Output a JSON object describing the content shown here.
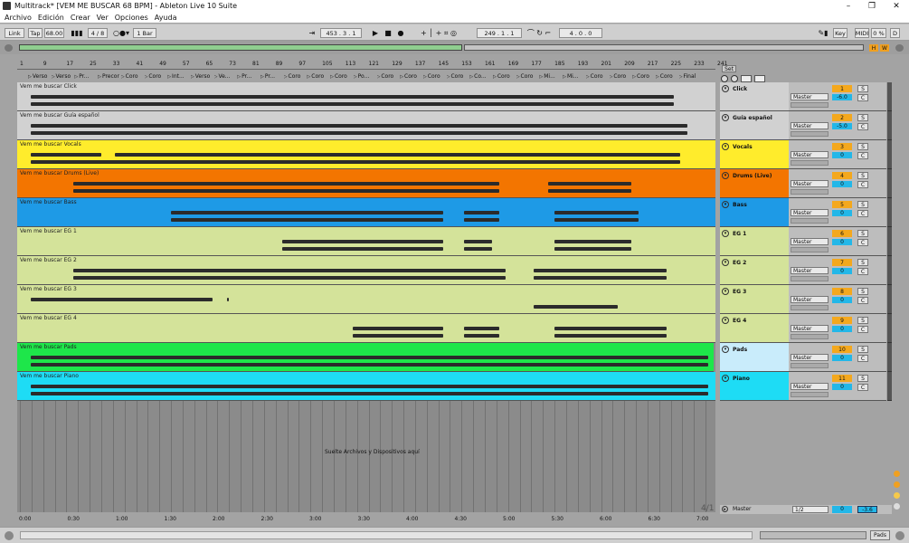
{
  "window": {
    "title": "Multitrack*  [VEM ME BUSCAR 68 BPM] - Ableton Live 10 Suite",
    "minimize": "–",
    "restore": "❐",
    "close": "✕"
  },
  "menu": [
    "Archivo",
    "Edición",
    "Crear",
    "Ver",
    "Opciones",
    "Ayuda"
  ],
  "controlbar": {
    "link": "Link",
    "tap": "Tap",
    "tempo": "68.00",
    "signature": "4 / 8",
    "metronome": "1 Bar",
    "position": "453 .   3 .   1",
    "loop_start": "249 .   1 .   1",
    "loop_length": "4 .   0 .   0",
    "key": "Key",
    "midi": "MIDI",
    "cpu": "0 %",
    "d": "D"
  },
  "overview": {
    "h": "H",
    "w": "W"
  },
  "ruler": [
    "1",
    "9",
    "17",
    "25",
    "33",
    "41",
    "49",
    "57",
    "65",
    "73",
    "81",
    "89",
    "97",
    "105",
    "113",
    "121",
    "129",
    "137",
    "145",
    "153",
    "161",
    "169",
    "177",
    "185",
    "193",
    "201",
    "209",
    "217",
    "225",
    "233",
    "241"
  ],
  "locators": [
    "Verso",
    "Verso",
    "Pr...",
    "Precoro",
    "Coro",
    "Coro",
    "Int...",
    "Verso",
    "Ve...",
    "Pr...",
    "Pr...",
    "Coro",
    "Coro",
    "Coro",
    "Po...",
    "Coro",
    "Coro",
    "Coro",
    "Coro",
    "Co...",
    "Coro",
    "Coro",
    "Mi...",
    "Mi...",
    "Coro",
    "Coro",
    "Coro",
    "Coro",
    "Final"
  ],
  "set_label": "Set",
  "tracks": [
    {
      "clip": "Vem me buscar Click",
      "name": "Click",
      "num": "1",
      "vol": "-6.0",
      "route": "Master",
      "color": "#d1d1d1",
      "lane": "#d1d1d1"
    },
    {
      "clip": "Vem me buscar Guía español",
      "name": "Guía español",
      "num": "2",
      "vol": "-5.0",
      "route": "Master",
      "color": "#d1d1d1",
      "lane": "#d1d1d1"
    },
    {
      "clip": "Vem me buscar Vocals",
      "name": "Vocals",
      "num": "3",
      "vol": "0",
      "route": "Master",
      "color": "#ffec2c",
      "lane": "#ffec2c"
    },
    {
      "clip": "Vem me buscar Drums (Live)",
      "name": "Drums (Live)",
      "num": "4",
      "vol": "0",
      "route": "Master",
      "color": "#f37500",
      "lane": "#f37500"
    },
    {
      "clip": "Vem me buscar Bass",
      "name": "Bass",
      "num": "5",
      "vol": "0",
      "route": "Master",
      "color": "#1e9ae6",
      "lane": "#1e9ae6"
    },
    {
      "clip": "Vem me buscar EG 1",
      "name": "EG 1",
      "num": "6",
      "vol": "0",
      "route": "Master",
      "color": "#d4e39a",
      "lane": "#d4e39a"
    },
    {
      "clip": "Vem me buscar EG 2",
      "name": "EG 2",
      "num": "7",
      "vol": "0",
      "route": "Master",
      "color": "#d4e39a",
      "lane": "#d4e39a"
    },
    {
      "clip": "Vem me buscar EG 3",
      "name": "EG 3",
      "num": "8",
      "vol": "0",
      "route": "Master",
      "color": "#d4e39a",
      "lane": "#d4e39a"
    },
    {
      "clip": "Vem me buscar EG 4",
      "name": "EG 4",
      "num": "9",
      "vol": "0",
      "route": "Master",
      "color": "#d4e39a",
      "lane": "#d4e39a"
    },
    {
      "clip": "Vem me buscar Pads",
      "name": "Pads",
      "num": "10",
      "vol": "0",
      "route": "Master",
      "color": "#c9ecfb",
      "lane": "#1ee64a"
    },
    {
      "clip": "Vem me buscar Piano",
      "name": "Piano",
      "num": "11",
      "vol": "0",
      "route": "Master",
      "color": "#1edcf5",
      "lane": "#1edcf5"
    }
  ],
  "dropzone": "Suelte Archivos y Dispositivos aquí",
  "timeruler": [
    "0:00",
    "0:30",
    "1:00",
    "1:30",
    "2:00",
    "2:30",
    "3:00",
    "3:30",
    "4:00",
    "4:30",
    "5:00",
    "5:30",
    "6:00",
    "6:30",
    "7:00"
  ],
  "zoom": "4/1",
  "master": {
    "name": "Master",
    "route": "1/2",
    "vol": "0",
    "meter": "-3.6"
  },
  "status": {
    "pads": "Pads"
  },
  "solo_label": "S",
  "cue_label": "C"
}
